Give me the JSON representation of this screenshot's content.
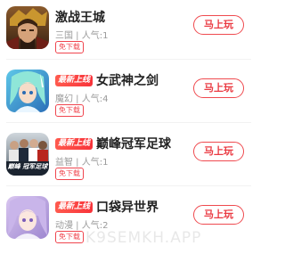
{
  "games": [
    {
      "name": "激战王城",
      "badge": "",
      "meta": "三国 | 人气:1",
      "tag": "免下载",
      "action": "马上玩",
      "icon": "warrior-cover"
    },
    {
      "name": "女武神之剑",
      "badge": "最新上线",
      "meta": "魔幻 | 人气:4",
      "tag": "免下载",
      "action": "马上玩",
      "icon": "valkyrie-cover"
    },
    {
      "name": "巅峰冠军足球",
      "badge": "最新上线",
      "meta": "益智 | 人气:1",
      "tag": "免下载",
      "action": "马上玩",
      "icon": "football-cover",
      "cover_text": "巅峰 冠军足球"
    },
    {
      "name": "口袋异世界",
      "badge": "最新上线",
      "meta": "动漫 | 人气:2",
      "tag": "免下载",
      "action": "马上玩",
      "icon": "anime-girl-cover"
    }
  ],
  "watermark": "K9SEMKH.APP",
  "colors": {
    "accent": "#f0454e",
    "title": "#222222",
    "meta": "#9a9a9a"
  }
}
